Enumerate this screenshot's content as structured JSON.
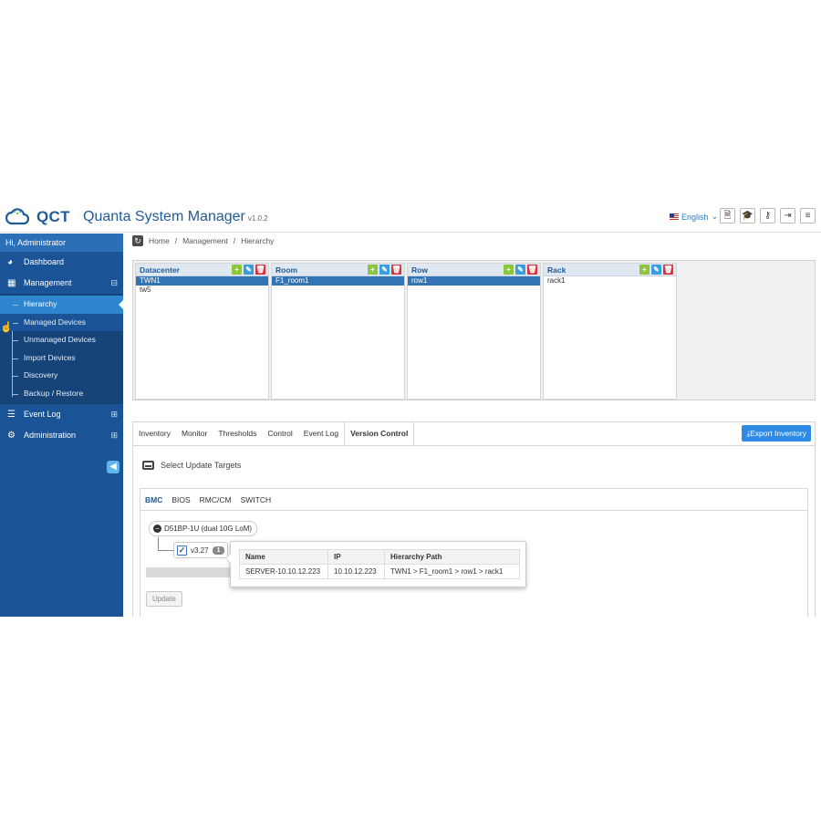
{
  "header": {
    "brand": "QCT",
    "app_name": "Quanta System Manager",
    "version": "v1.0.2",
    "language": "English",
    "toolbar_icons": [
      "document-icon",
      "graduation-cap-icon",
      "key-icon",
      "sign-out-icon",
      "menu-icon"
    ]
  },
  "sidebar": {
    "user": "Hi, Administrator",
    "items": [
      {
        "label": "Dashboard",
        "icon": "dashboard-icon"
      },
      {
        "label": "Management",
        "icon": "table-icon",
        "expand": "⊟"
      },
      {
        "label": "Event Log",
        "icon": "list-icon",
        "expand": "⊞"
      },
      {
        "label": "Administration",
        "icon": "cogs-icon",
        "expand": "⊞"
      }
    ],
    "subitems": [
      "Hierarchy",
      "Managed Devices",
      "Unmanaged Devices",
      "Import Devices",
      "Discovery",
      "Backup / Restore"
    ]
  },
  "breadcrumb": {
    "home": "Home",
    "sep": "/",
    "management": "Management",
    "current": "Hierarchy"
  },
  "hierarchy": {
    "datacenter": {
      "title": "Datacenter",
      "rows": [
        "TWN1",
        "tw5"
      ],
      "selected": "TWN1"
    },
    "room": {
      "title": "Room",
      "rows": [
        "F1_room1"
      ],
      "selected": "F1_room1"
    },
    "row": {
      "title": "Row",
      "rows": [
        "row1"
      ],
      "selected": "row1"
    },
    "rack": {
      "title": "Rack",
      "rows": [
        "rack1"
      ],
      "selected": ""
    }
  },
  "tabs": [
    "Inventory",
    "Monitor",
    "Thresholds",
    "Control",
    "Event Log",
    "Version Control"
  ],
  "active_tab": "Version Control",
  "export_button": "Export Inventory",
  "select_targets": "Select Update Targets",
  "subtabs": [
    "BMC",
    "BIOS",
    "RMC/CM",
    "SWITCH"
  ],
  "active_subtab": "BMC",
  "tree": {
    "node": "D51BP-1U (dual 10G LoM)",
    "leaf_version": "v3.27",
    "leaf_count": "1",
    "checked": true
  },
  "update_button": "Update",
  "popup": {
    "columns": [
      "Name",
      "IP",
      "Hierarchy Path"
    ],
    "rows": [
      [
        "SERVER-10.10.12.223",
        "10.10.12.223",
        "TWN1 > F1_room1 > row1 > rack1"
      ]
    ]
  },
  "colors": {
    "sidebar": "#1b5496",
    "active": "#2e86cf",
    "brand": "#1f5b97",
    "add": "#8cc63f",
    "edit": "#3a9de0",
    "delete": "#d9303a"
  }
}
